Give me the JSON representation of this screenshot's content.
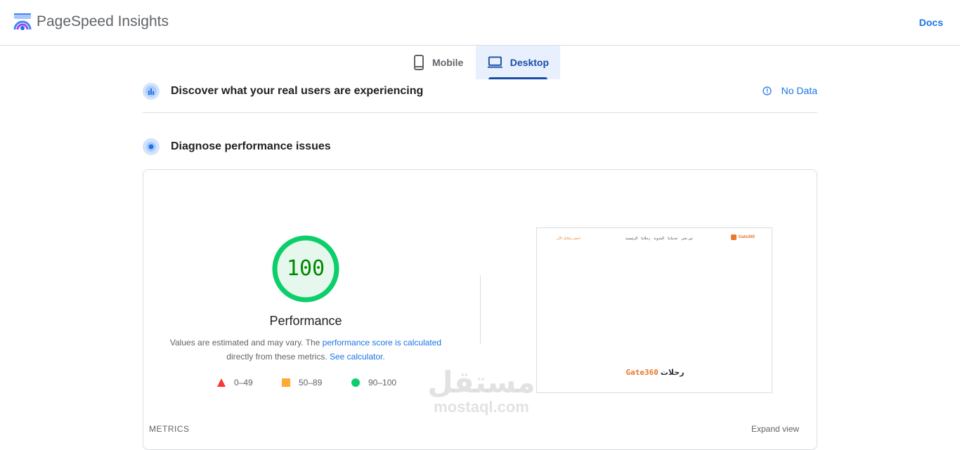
{
  "header": {
    "app_title": "PageSpeed Insights",
    "docs_label": "Docs",
    "logo_icon": "pagespeed-logo-icon"
  },
  "tabs": [
    {
      "label": "Mobile",
      "icon": "phone-icon",
      "selected": false
    },
    {
      "label": "Desktop",
      "icon": "laptop-icon",
      "selected": true
    }
  ],
  "field_data": {
    "title": "Discover what your real users are experiencing",
    "status": "No Data",
    "status_icon": "info-icon"
  },
  "lab_data": {
    "title": "Diagnose performance issues",
    "score": "100",
    "score_fraction": 1.0,
    "category": "Performance",
    "desc_prefix": "Values are estimated and may vary. The ",
    "desc_link1": "performance score is calculated",
    "desc_middle": "directly from these metrics. ",
    "desc_link2": "See calculator.",
    "legend": [
      {
        "range": "0–49",
        "shape": "triangle",
        "color": "#ff3333"
      },
      {
        "range": "50–89",
        "shape": "square",
        "color": "#ffaa33"
      },
      {
        "range": "90–100",
        "shape": "circle",
        "color": "#0cce6b"
      }
    ],
    "metrics_label": "METRICS",
    "expand_label": "Expand view"
  },
  "screenshot": {
    "cta": "احجز مكانك الآن",
    "nav": [
      "الرئيسية",
      "رحلاتنا",
      "المدونة",
      "خدماتنا",
      "من نحن"
    ],
    "logo_text": "Gate360",
    "hero_word": "رحلات",
    "hero_brand": "Gate360"
  },
  "watermark": {
    "arabic": "مستقل",
    "latin": "mostaql.com"
  },
  "colors": {
    "accent": "#1a73e8",
    "pass": "#0cce6b",
    "pass_text": "#008800",
    "pass_fill": "#e6f8ed"
  }
}
